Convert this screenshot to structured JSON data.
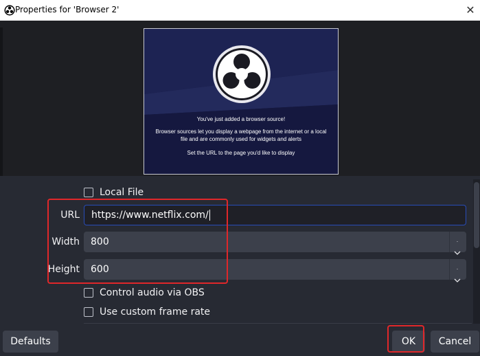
{
  "window": {
    "title": "Properties for 'Browser 2'",
    "close_glyph": "✕",
    "app_icon": "obs-logo-icon"
  },
  "preview": {
    "line1": "You've just added a browser source!",
    "line2a": "Browser sources let you display a webpage from the internet or a local",
    "line2b": "file and are commonly used for widgets and alerts",
    "line3": "Set the URL to the page you'd like to display",
    "logo_icon": "obs-logo-icon"
  },
  "properties": {
    "local_file": {
      "label": "Local File",
      "checked": false
    },
    "url": {
      "label": "URL",
      "value": "https://www.netflix.com/"
    },
    "width": {
      "label": "Width",
      "value": "800"
    },
    "height": {
      "label": "Height",
      "value": "600"
    },
    "control_audio": {
      "label": "Control audio via OBS",
      "checked": false
    },
    "custom_frame_rate": {
      "label": "Use custom frame rate",
      "checked": false
    }
  },
  "buttons": {
    "defaults": "Defaults",
    "ok": "OK",
    "cancel": "Cancel"
  },
  "colors": {
    "background": "#272a33",
    "input": "#3c404b",
    "accent_border": "#284cb8",
    "highlight": "#e0272a"
  }
}
